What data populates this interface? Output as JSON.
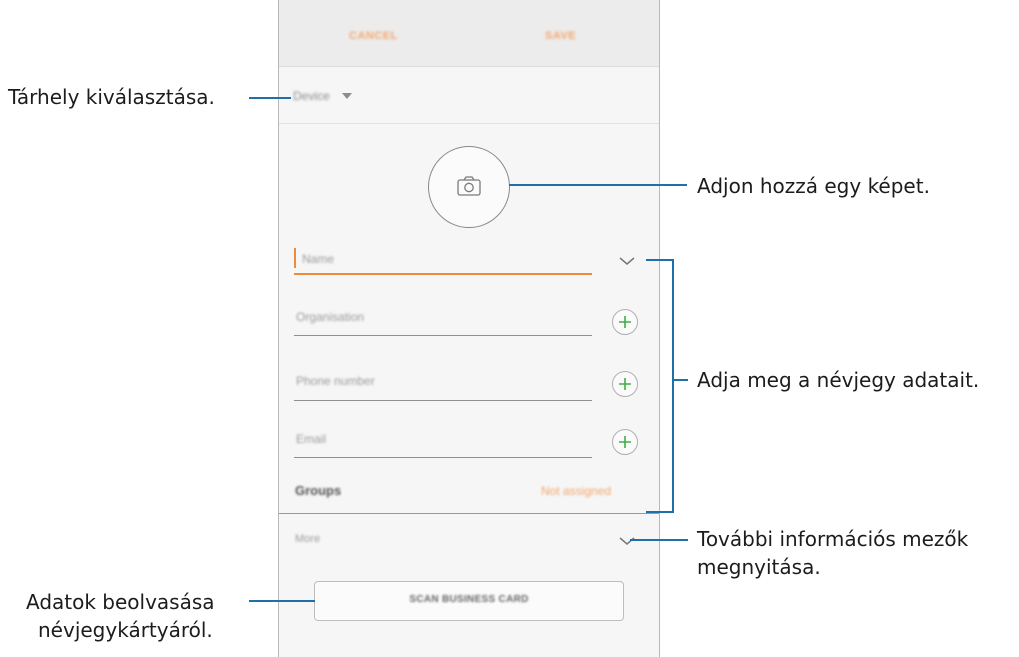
{
  "header": {
    "cancel_label": "CANCEL",
    "save_label": "SAVE"
  },
  "storage": {
    "selected": "Device"
  },
  "photo": {
    "icon": "camera-icon"
  },
  "fields": {
    "name_placeholder": "Name",
    "organisation_placeholder": "Organisation",
    "phone_placeholder": "Phone number",
    "email_placeholder": "Email"
  },
  "groups": {
    "label": "Groups",
    "value": "Not assigned"
  },
  "more": {
    "label": "More"
  },
  "scan_button": {
    "label": "SCAN BUSINESS CARD"
  },
  "callouts": {
    "storage": "Tárhely kiválasztása.",
    "photo": "Adjon hozzá egy képet.",
    "details": "Adja meg a névjegy adatait.",
    "more_line1": "További információs mezők",
    "more_line2": "megnyitása.",
    "scan_line1": "Adatok beolvasása",
    "scan_line2": "névjegykártyáról."
  },
  "colors": {
    "accent_orange": "#f08a3c",
    "plus_green": "#3fae49",
    "callout_line": "#1f6fa8"
  }
}
